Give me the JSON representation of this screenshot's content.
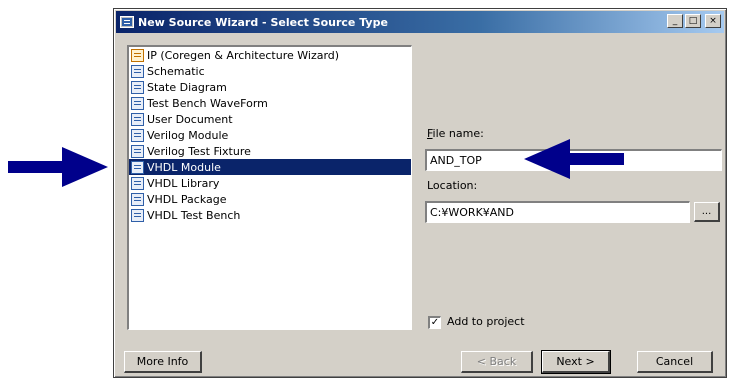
{
  "window": {
    "title": "New Source Wizard - Select Source Type",
    "controls": {
      "minimize": "_",
      "maximize": "□",
      "close": "×"
    }
  },
  "source_types": [
    {
      "label": "IP (Coregen & Architecture Wizard)",
      "icon": "ip-core-icon",
      "selected": false
    },
    {
      "label": "Schematic",
      "icon": "schematic-icon",
      "selected": false
    },
    {
      "label": "State Diagram",
      "icon": "state-diagram-icon",
      "selected": false
    },
    {
      "label": "Test Bench WaveForm",
      "icon": "waveform-icon",
      "selected": false
    },
    {
      "label": "User Document",
      "icon": "document-icon",
      "selected": false
    },
    {
      "label": "Verilog Module",
      "icon": "verilog-module-icon",
      "selected": false
    },
    {
      "label": "Verilog Test Fixture",
      "icon": "verilog-fixture-icon",
      "selected": false
    },
    {
      "label": "VHDL Module",
      "icon": "vhdl-module-icon",
      "selected": true
    },
    {
      "label": "VHDL Library",
      "icon": "vhdl-library-icon",
      "selected": false
    },
    {
      "label": "VHDL Package",
      "icon": "vhdl-package-icon",
      "selected": false
    },
    {
      "label": "VHDL Test Bench",
      "icon": "vhdl-testbench-icon",
      "selected": false
    }
  ],
  "file_name": {
    "label": "File name:",
    "value": "AND_TOP"
  },
  "location": {
    "label": "Location:",
    "value": "C:¥WORK¥AND",
    "browse": "..."
  },
  "add_to_project": {
    "label": "Add to project",
    "checked": true,
    "check_mark": "✓"
  },
  "buttons": {
    "more_info": "More Info",
    "back": "< Back",
    "next": "Next >",
    "cancel": "Cancel"
  },
  "annotations": {
    "arrow_color": "#00008b",
    "arrows": [
      "arrow-right-icon",
      "arrow-left-icon"
    ]
  }
}
